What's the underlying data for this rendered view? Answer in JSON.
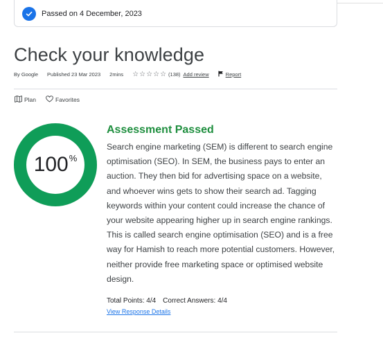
{
  "banner": {
    "text": "Passed on 4 December, 2023"
  },
  "header": {
    "title": "Check your knowledge",
    "author": "By Google",
    "published": "Published 23 Mar 2023",
    "duration": "2mins",
    "rating_count": "(138)",
    "add_review": "Add review",
    "report": "Report"
  },
  "actions": {
    "plan": "Plan",
    "favorites": "Favorites"
  },
  "result": {
    "score_value": "100",
    "score_symbol": "%",
    "score_fraction": 1.0,
    "ring_color": "#0f9d58",
    "title": "Assessment Passed",
    "body": "Search engine marketing (SEM) is different to search engine optimisation (SEO). In SEM, the business pays to enter an auction. They then bid for advertising space on a website, and whoever wins gets to show their search ad. Tagging keywords within your content could increase the chance of your website appearing higher up in search engine rankings. This is called search engine optimisation (SEO) and is a free way for Hamish to reach more potential customers. However, neither provide free marketing space or optimised website design.",
    "total_points": "Total Points: 4/4",
    "correct_answers": "Correct Answers: 4/4",
    "details_link": "View Response Details"
  }
}
